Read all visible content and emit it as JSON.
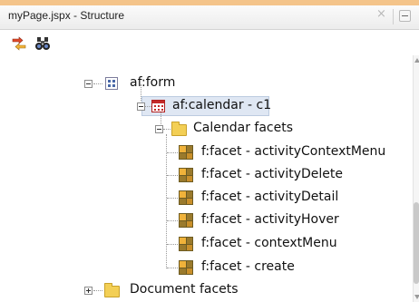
{
  "window": {
    "title": "myPage.jspx - Structure",
    "close_glyph": "×"
  },
  "toolbar": {
    "icons": [
      "sync-with-editor-icon",
      "find-binoculars-icon"
    ]
  },
  "tree": {
    "nodes": [
      {
        "label": "af:form",
        "icon": "form-icon",
        "expanded": true
      },
      {
        "label": "af:calendar - c1",
        "icon": "calendar-icon",
        "expanded": true,
        "selected": true
      },
      {
        "label": "Calendar facets",
        "icon": "folder-icon",
        "expanded": true
      },
      {
        "label": "f:facet - activityContextMenu",
        "icon": "facet-icon"
      },
      {
        "label": "f:facet - activityDelete",
        "icon": "facet-icon"
      },
      {
        "label": "f:facet - activityDetail",
        "icon": "facet-icon"
      },
      {
        "label": "f:facet - activityHover",
        "icon": "facet-icon"
      },
      {
        "label": "f:facet - contextMenu",
        "icon": "facet-icon"
      },
      {
        "label": "f:facet - create",
        "icon": "facet-icon"
      },
      {
        "label": "Document facets",
        "icon": "folder-icon",
        "expanded": false
      }
    ]
  },
  "colors": {
    "accent_strip": "#f4c48a",
    "selection": "#dfe7f3"
  }
}
